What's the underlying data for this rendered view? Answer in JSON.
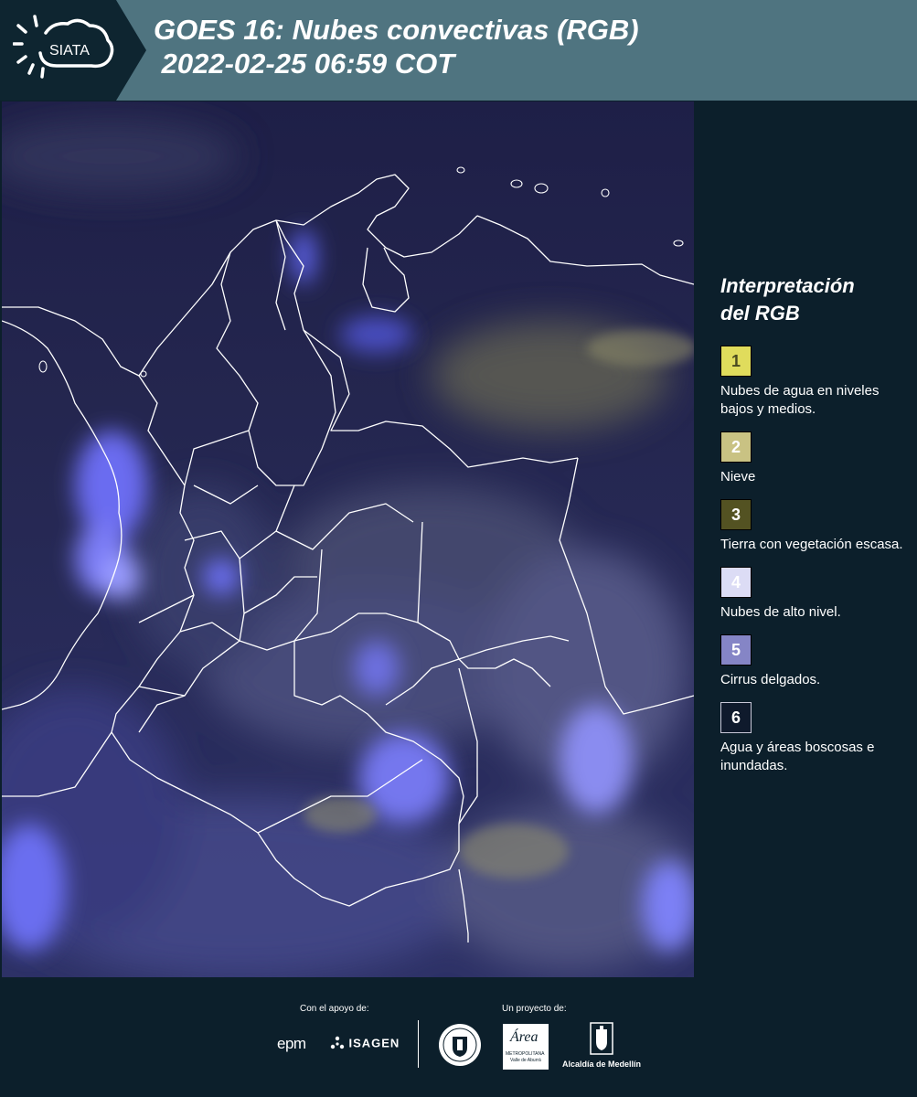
{
  "header": {
    "logo_text": "SIATA",
    "title_line1": "GOES 16: Nubes convectivas (RGB)",
    "title_line2": " 2022-02-25 06:59 COT"
  },
  "map": {
    "description_icon": "satellite-rgb-map-colombia"
  },
  "legend": {
    "title_line1": "Interpretación",
    "title_line2": "del RGB",
    "items": [
      {
        "number": "1",
        "label": "Nubes de agua en niveles bajos y medios.",
        "color": "#e0dc5c",
        "text_color": "#4a4a20"
      },
      {
        "number": "2",
        "label": "Nieve",
        "color": "#c9c283",
        "text_color": "#ffffff"
      },
      {
        "number": "3",
        "label": "Tierra con vegetación escasa.",
        "color": "#535222",
        "text_color": "#ffffff"
      },
      {
        "number": "4",
        "label": "Nubes de alto nivel.",
        "color": "#dcdcf5",
        "text_color": "#ffffff"
      },
      {
        "number": "5",
        "label": "Cirrus delgados.",
        "color": "#8585c6",
        "text_color": "#ffffff"
      },
      {
        "number": "6",
        "label": "Agua y áreas boscosas e inundadas.",
        "color": "#0f1a2c",
        "text_color": "#ffffff"
      }
    ]
  },
  "footer": {
    "support_label": "Con el apoyo de:",
    "project_label": "Un proyecto de:",
    "sponsors": {
      "epm": "epm",
      "isagen": "ISAGEN",
      "area_name": "Área",
      "area_sub1": "METROPOLITANA",
      "area_sub2": "Valle de Aburrá",
      "alcaldia": "Alcaldía de Medellín"
    }
  }
}
